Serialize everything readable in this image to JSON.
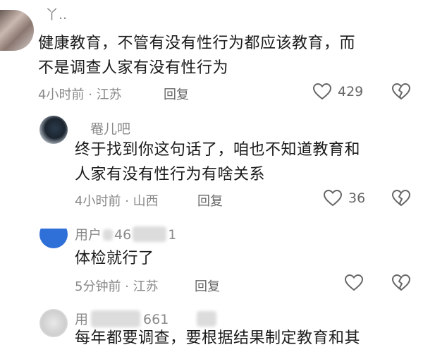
{
  "comments": [
    {
      "name": "丫..",
      "text_lines": [
        "健康教育，不管有没有性行为都应该教育，而",
        "不是调查人家有没有性行为"
      ],
      "time": "4小时前",
      "location": "江苏",
      "reply_label": "回复",
      "likes": "429"
    },
    {
      "name": "罨儿吧",
      "text_lines": [
        "终于找到你这句话了，咱也不知道教育和",
        "人家有没有性行为有啥关系"
      ],
      "time": "4小时前",
      "location": "山西",
      "reply_label": "回复",
      "likes": "36"
    },
    {
      "name_prefix": "用户",
      "name_mid": "46",
      "name_suffix": "1",
      "text_lines": [
        "体检就行了"
      ],
      "time": "5分钟前",
      "location": "江苏",
      "reply_label": "回复"
    },
    {
      "name_prefix": "用",
      "name_suffix": "661",
      "text_lines": [
        "每年都要调查，要根据结果制定教育和其"
      ]
    }
  ],
  "meta_separator": "·",
  "icons": {
    "like": "heart-outline-icon",
    "dislike": "broken-heart-icon"
  }
}
